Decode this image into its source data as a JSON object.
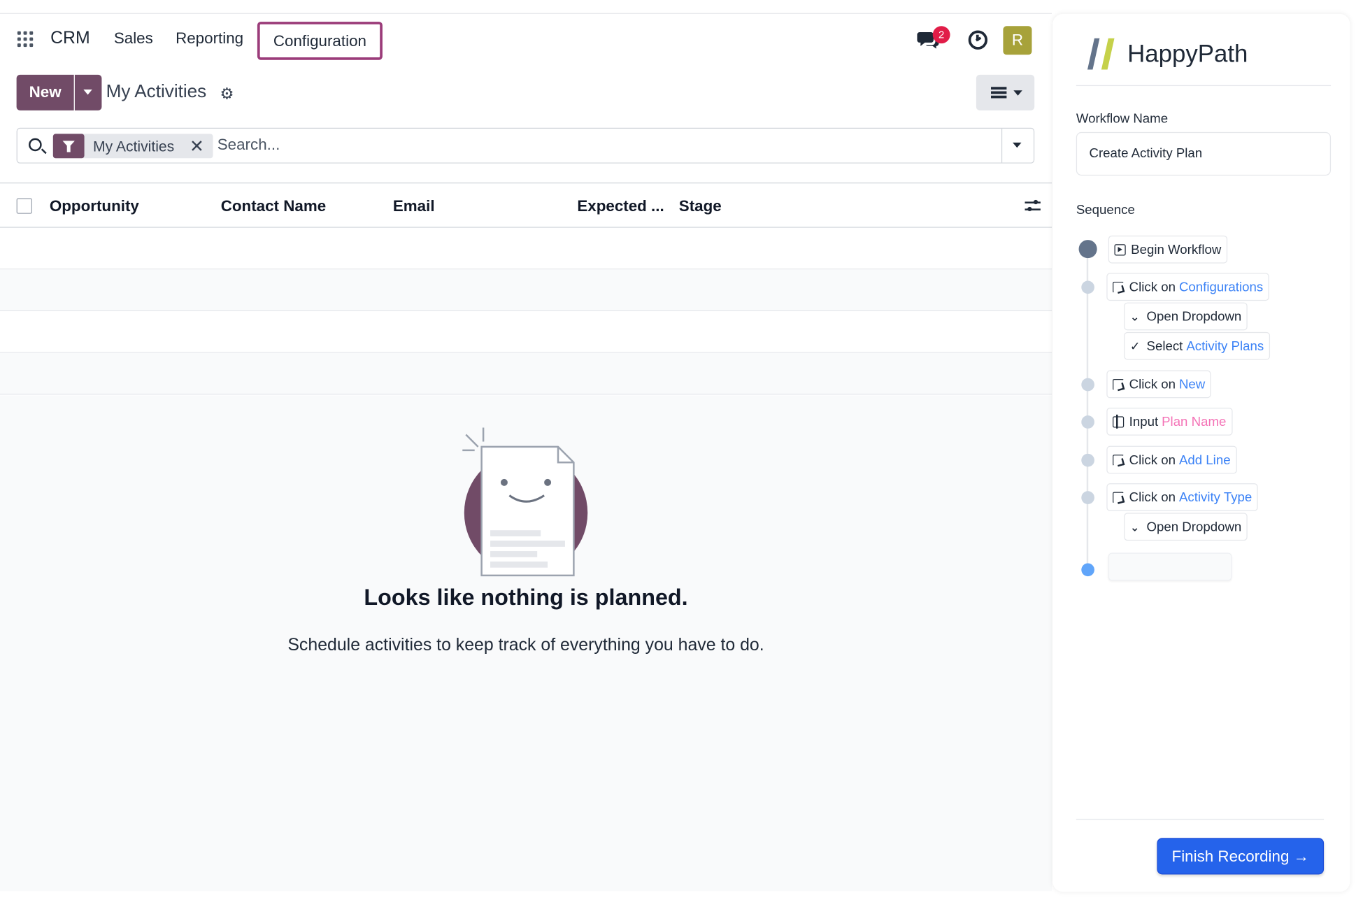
{
  "navbar": {
    "app_name": "CRM",
    "menu": [
      "Sales",
      "Reporting",
      "Configuration"
    ],
    "messages_badge": "2",
    "avatar_initial": "R"
  },
  "control_panel": {
    "new_label": "New",
    "title": "My Activities"
  },
  "search": {
    "facet_label": "My Activities",
    "placeholder": "Search..."
  },
  "table": {
    "columns": [
      "Opportunity",
      "Contact Name",
      "Email",
      "Expected ...",
      "Stage"
    ]
  },
  "empty_state": {
    "title": "Looks like nothing is planned.",
    "subtitle": "Schedule activities to keep track of everything you have to do."
  },
  "panel": {
    "brand": "HappyPath",
    "workflow_name_label": "Workflow Name",
    "workflow_name_value": "Create Activity Plan",
    "sequence_label": "Sequence",
    "steps": [
      {
        "text": "Begin Workflow",
        "target": ""
      },
      {
        "text": "Click on",
        "target": "Configurations"
      },
      {
        "text": "Open Dropdown",
        "target": ""
      },
      {
        "text": "Select",
        "target": "Activity Plans"
      },
      {
        "text": "Click on",
        "target": "New"
      },
      {
        "text": "Input",
        "target": "Plan Name"
      },
      {
        "text": "Click on",
        "target": "Add Line"
      },
      {
        "text": "Click on",
        "target": "Activity Type"
      },
      {
        "text": "Open Dropdown",
        "target": ""
      }
    ],
    "finish_label": "Finish Recording →"
  },
  "colors": {
    "brand_purple": "#714b67",
    "config_highlight": "#9b3c7a",
    "avatar": "#a7a23a",
    "badge": "#e11d48",
    "link_blue": "#3b82f6",
    "input_pink": "#f472b6",
    "finish_button": "#2563eb"
  }
}
